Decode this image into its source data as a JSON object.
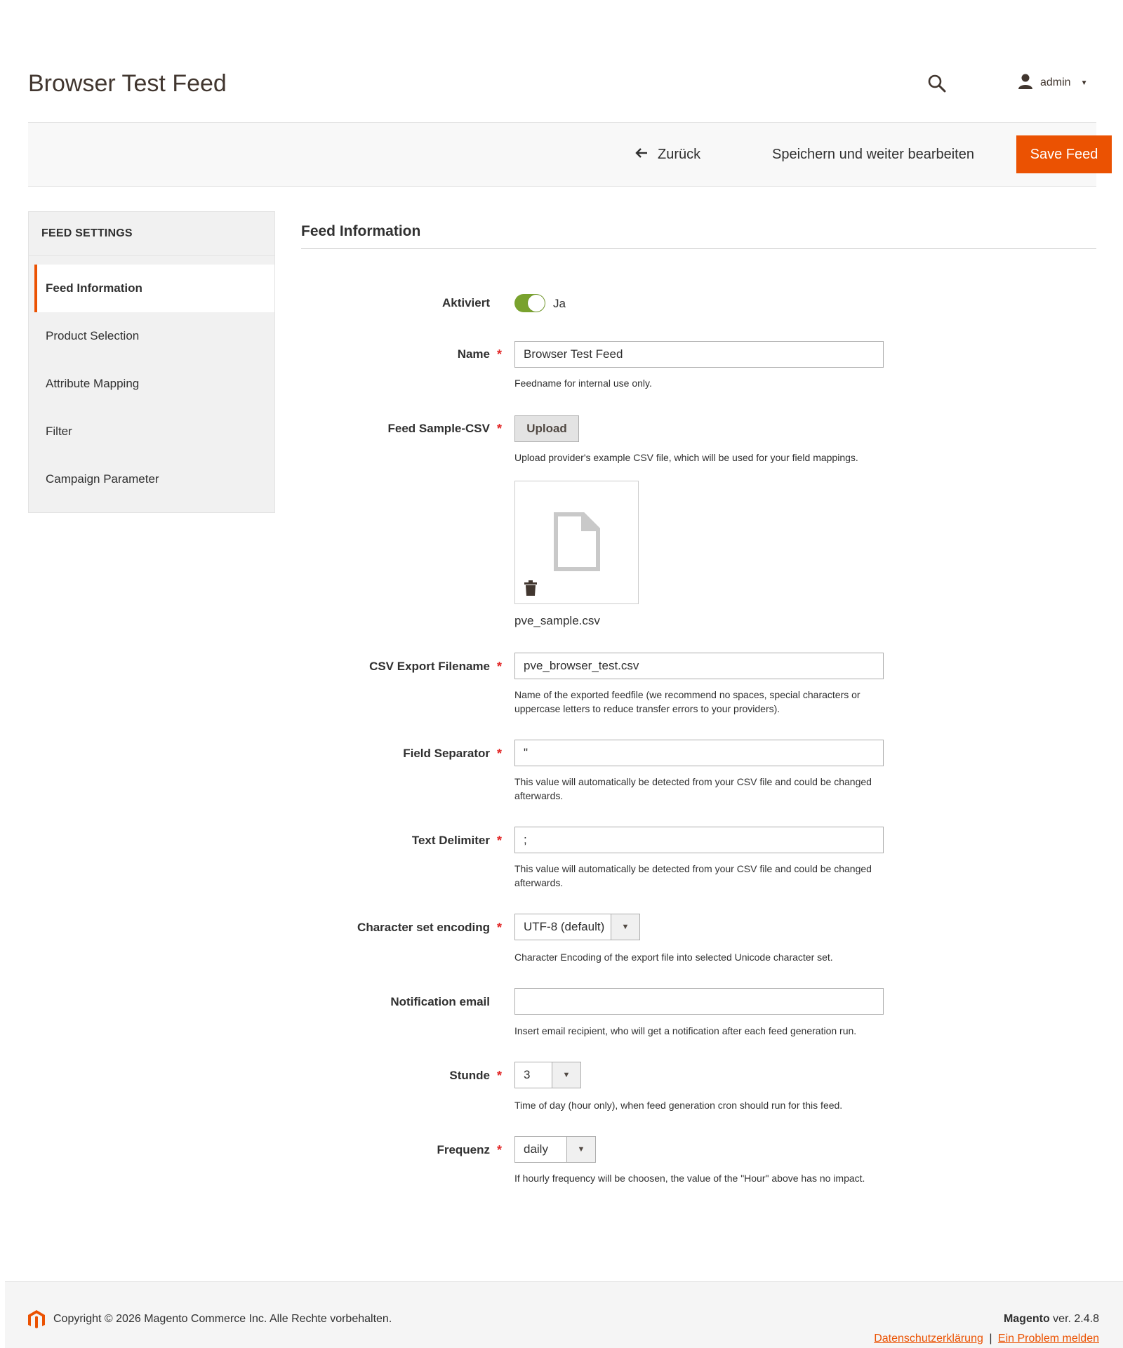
{
  "page": {
    "title": "Browser Test Feed"
  },
  "header": {
    "user_name": "admin"
  },
  "actions": {
    "back_label": "Zurück",
    "save_continue_label": "Speichern und weiter bearbeiten",
    "save_label": "Save Feed"
  },
  "sidebar": {
    "heading": "FEED SETTINGS",
    "items": [
      {
        "label": "Feed Information",
        "active": true
      },
      {
        "label": "Product Selection"
      },
      {
        "label": "Attribute Mapping"
      },
      {
        "label": "Filter"
      },
      {
        "label": "Campaign Parameter"
      }
    ]
  },
  "section": {
    "title": "Feed Information"
  },
  "form": {
    "active": {
      "label": "Aktiviert",
      "value_label": "Ja",
      "enabled": true
    },
    "name": {
      "label": "Name",
      "value": "Browser Test Feed",
      "note": "Feedname for internal use only."
    },
    "sample_csv": {
      "label": "Feed Sample-CSV",
      "button": "Upload",
      "note": "Upload provider's example CSV file, which will be used for your field mappings.",
      "file_name": "pve_sample.csv"
    },
    "export_filename": {
      "label": "CSV Export Filename",
      "value": "pve_browser_test.csv",
      "note": "Name of the exported feedfile (we recommend no spaces, special characters or uppercase letters to reduce transfer errors to your providers)."
    },
    "field_separator": {
      "label": "Field Separator",
      "value": "\"",
      "note": "This value will automatically be detected from your CSV file and could be changed afterwards."
    },
    "text_delimiter": {
      "label": "Text Delimiter",
      "value": ";",
      "note": "This value will automatically be detected from your CSV file and could be changed afterwards."
    },
    "encoding": {
      "label": "Character set encoding",
      "value": "UTF-8 (default)",
      "note": "Character Encoding of the export file into selected Unicode character set."
    },
    "notification_email": {
      "label": "Notification email",
      "value": "",
      "note": "Insert email recipient, who will get a notification after each feed generation run."
    },
    "hour": {
      "label": "Stunde",
      "value": "3",
      "note": "Time of day (hour only), when feed generation cron should run for this feed."
    },
    "frequency": {
      "label": "Frequenz",
      "value": "daily",
      "note": "If hourly frequency will be choosen, the value of the \"Hour\" above has no impact."
    },
    "required_mark": "*"
  },
  "footer": {
    "copyright": "Copyright © 2026 Magento Commerce Inc. Alle Rechte vorbehalten.",
    "brand": "Magento",
    "version": "ver. 2.4.8",
    "privacy_link": "Datenschutzerklärung",
    "separator": "|",
    "report_link": "Ein Problem melden"
  },
  "colors": {
    "accent": "#eb5202",
    "toggle_on": "#79a22e",
    "required": "#e22626"
  }
}
